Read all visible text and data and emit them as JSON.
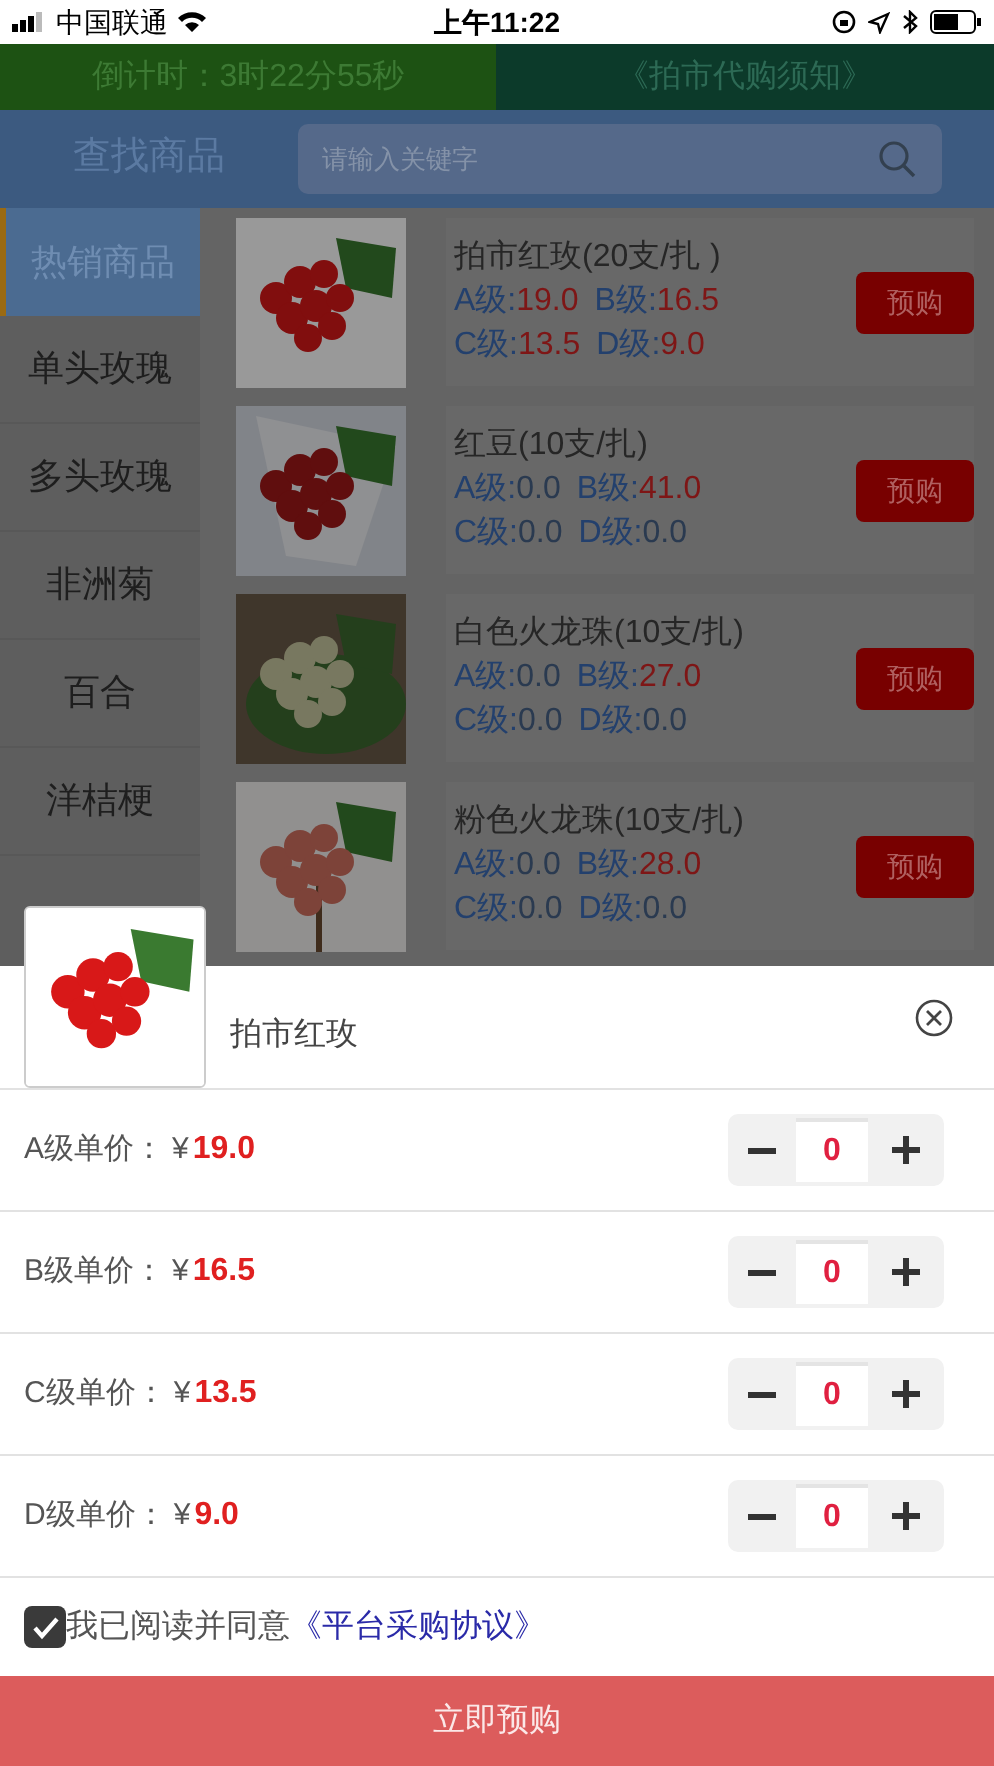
{
  "status_bar": {
    "carrier": "中国联通",
    "time": "上午11:22"
  },
  "banner": {
    "countdown": "倒计时：3时22分55秒",
    "notice": "《拍市代购须知》"
  },
  "search": {
    "title": "查找商品",
    "placeholder": "请输入关键字"
  },
  "categories": [
    {
      "label": "热销商品",
      "selected": true
    },
    {
      "label": "单头玫瑰",
      "selected": false
    },
    {
      "label": "多头玫瑰",
      "selected": false
    },
    {
      "label": "非洲菊",
      "selected": false
    },
    {
      "label": "百合",
      "selected": false
    },
    {
      "label": "洋桔梗",
      "selected": false
    }
  ],
  "products": [
    {
      "name": "拍市红玫(20支/扎 )",
      "grades": [
        {
          "label": "A级:",
          "value": "19.0",
          "highlighted": true
        },
        {
          "label": "B级:",
          "value": "16.5",
          "highlighted": true
        },
        {
          "label": "C级:",
          "value": "13.5",
          "highlighted": true
        },
        {
          "label": "D级:",
          "value": "9.0",
          "highlighted": true
        }
      ],
      "button": "预购"
    },
    {
      "name": "红豆(10支/扎)",
      "grades": [
        {
          "label": "A级:",
          "value": "0.0",
          "highlighted": false
        },
        {
          "label": "B级:",
          "value": "41.0",
          "highlighted": true
        },
        {
          "label": "C级:",
          "value": "0.0",
          "highlighted": false
        },
        {
          "label": "D级:",
          "value": "0.0",
          "highlighted": false
        }
      ],
      "button": "预购"
    },
    {
      "name": "白色火龙珠(10支/扎)",
      "grades": [
        {
          "label": "A级:",
          "value": "0.0",
          "highlighted": false
        },
        {
          "label": "B级:",
          "value": "27.0",
          "highlighted": true
        },
        {
          "label": "C级:",
          "value": "0.0",
          "highlighted": false
        },
        {
          "label": "D级:",
          "value": "0.0",
          "highlighted": false
        }
      ],
      "button": "预购"
    },
    {
      "name": "粉色火龙珠(10支/扎)",
      "grades": [
        {
          "label": "A级:",
          "value": "0.0",
          "highlighted": false
        },
        {
          "label": "B级:",
          "value": "28.0",
          "highlighted": true
        },
        {
          "label": "C级:",
          "value": "0.0",
          "highlighted": false
        },
        {
          "label": "D级:",
          "value": "0.0",
          "highlighted": false
        }
      ],
      "button": "预购"
    }
  ],
  "popup": {
    "product_name": "拍市红玫",
    "grades": [
      {
        "label": "A级单价：",
        "currency": "¥",
        "price": "19.0",
        "quantity": "0"
      },
      {
        "label": "B级单价：",
        "currency": "¥",
        "price": "16.5",
        "quantity": "0"
      },
      {
        "label": "C级单价：",
        "currency": "¥",
        "price": "13.5",
        "quantity": "0"
      },
      {
        "label": "D级单价：",
        "currency": "¥",
        "price": "9.0",
        "quantity": "0"
      }
    ],
    "agreement": {
      "checked": true,
      "text": "我已阅读并同意",
      "link": "《平台采购协议》"
    },
    "submit": "立即预购"
  }
}
